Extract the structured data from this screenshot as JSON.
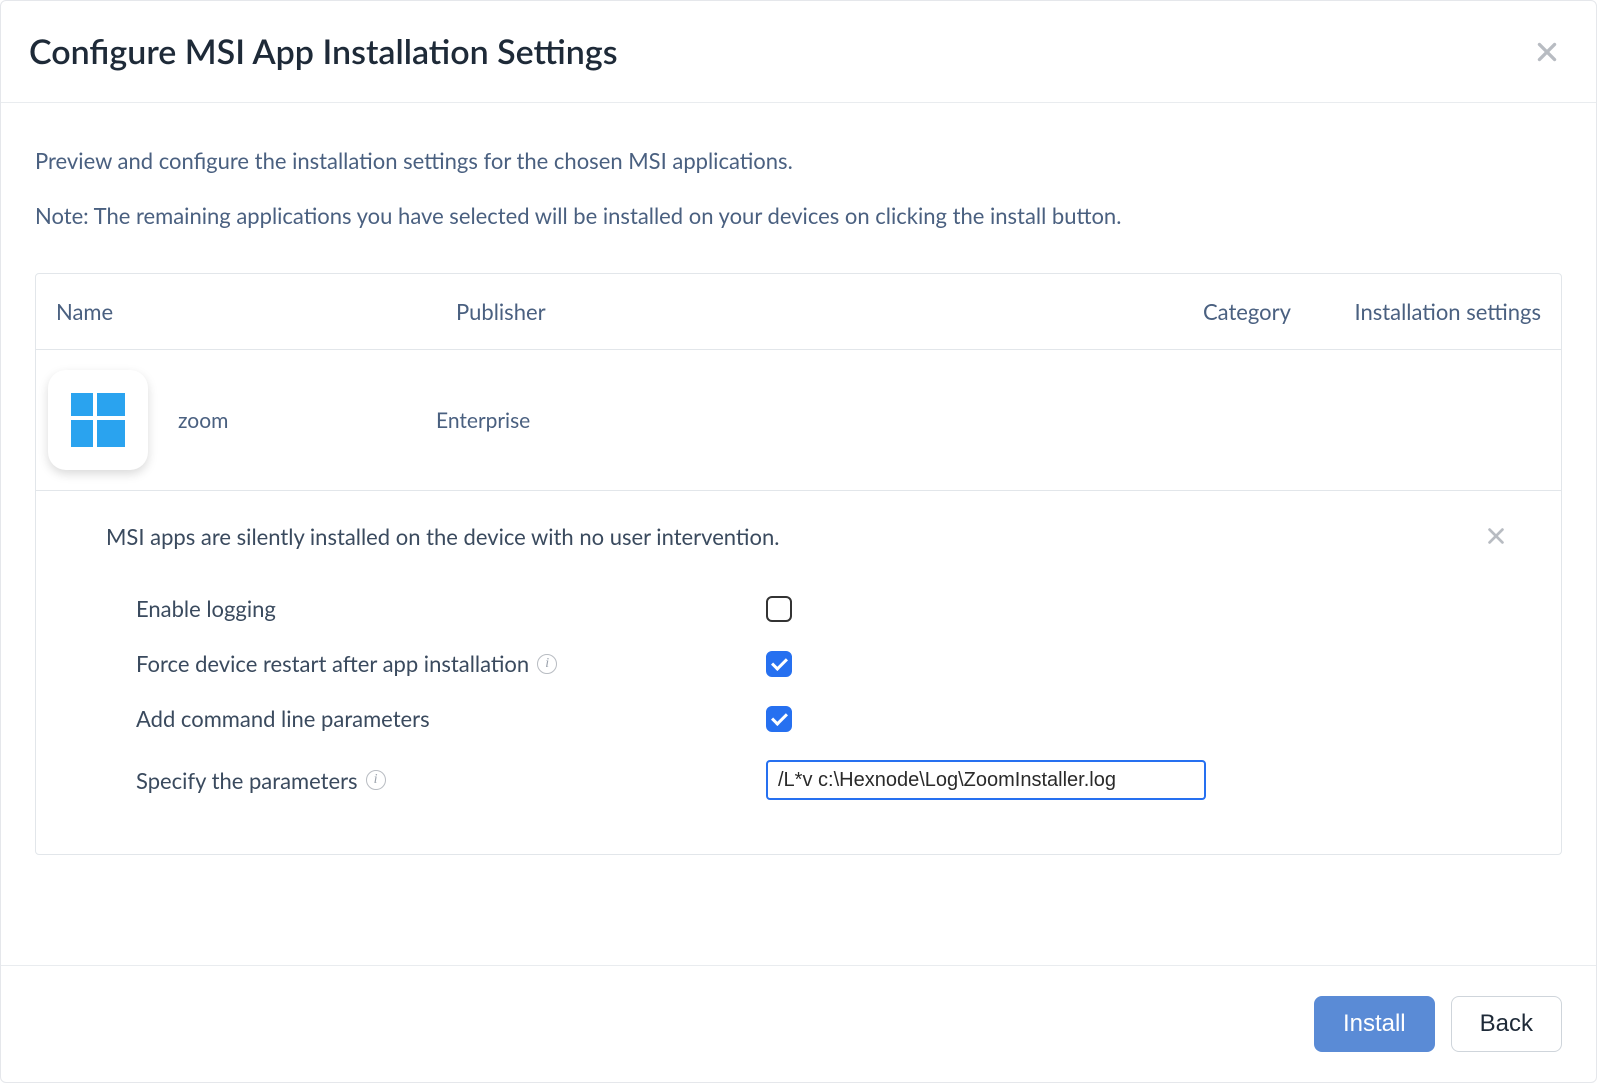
{
  "header": {
    "title": "Configure MSI App Installation Settings"
  },
  "intro": {
    "line1": "Preview and configure the installation settings for the chosen MSI applications.",
    "line2": "Note: The remaining applications you have selected will be installed on your devices on clicking the install button."
  },
  "table": {
    "headers": {
      "name": "Name",
      "publisher": "Publisher",
      "category": "Category",
      "settings": "Installation settings"
    },
    "row": {
      "name": "zoom",
      "publisher": "Enterprise",
      "category": "",
      "icon": "windows"
    }
  },
  "panel": {
    "intro": "MSI apps are silently installed on the device with no user intervention.",
    "fields": {
      "enable_logging": {
        "label": "Enable logging",
        "checked": false
      },
      "force_restart": {
        "label": "Force device restart after app installation",
        "checked": true,
        "info": true
      },
      "add_params": {
        "label": "Add command line parameters",
        "checked": true
      },
      "specify_params": {
        "label": "Specify the parameters",
        "value": "/L*v c:\\Hexnode\\Log\\ZoomInstaller.log",
        "info": true
      }
    }
  },
  "footer": {
    "install": "Install",
    "back": "Back"
  }
}
